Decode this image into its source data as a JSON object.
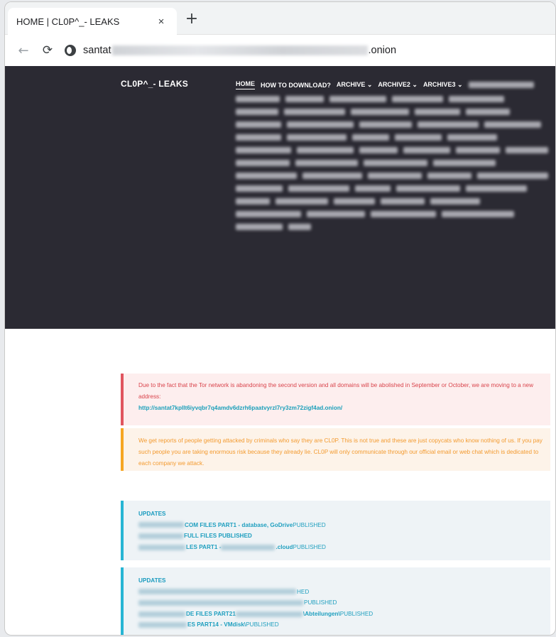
{
  "browser": {
    "tab_title": "HOME | CL0P^_- LEAKS",
    "tab_close": "×",
    "new_tab": "+",
    "back_icon": "←",
    "reload_icon": "⟳",
    "url_prefix": "santat",
    "url_suffix": ".onion"
  },
  "site": {
    "brand": "CL0P^_- LEAKS",
    "nav": {
      "home": "HOME",
      "how_to_download": "HOW TO DOWNLOAD?",
      "archive": "ARCHIVE ⌄",
      "archive2": "ARCHIVE2 ⌄",
      "archive3": "ARCHIVE3 ⌄"
    }
  },
  "notices": {
    "tor": {
      "text": "Due to the fact that the Tor network is abandoning the second version and all domains will be abolished in September or October, we are moving to a new address:",
      "address": "http://santat7kpllt6iyvqbr7q4amdv6dzrh6paatvyrzl7ry3zm72zigf4ad.onion/"
    },
    "copycats": {
      "text": "We get reports of people getting attacked by criminals who say they are CL0P. This is not true and these are just copycats who know nothing of us. If you pay such people you are taking enormous risk because they already lie. CL0P will only communicate through our official email or web chat which is dedicated to each company we attack."
    }
  },
  "updates": [
    {
      "title": "UPDATES",
      "rows": [
        {
          "bold": "COM FILES PART1 - database, GoDrive",
          "normal": " PUBLISHED"
        },
        {
          "bold": "FULL FILES PUBLISHED",
          "normal": ""
        },
        {
          "bold": "LES PART1 - ",
          "bold2": ".cloud",
          "normal": " PUBLISHED"
        }
      ]
    },
    {
      "title": "UPDATES",
      "rows": [
        {
          "normal": "HED"
        },
        {
          "normal": " PUBLISHED"
        },
        {
          "bold": "DE FILES PART21",
          "bold2": "\\Abteilungen\\",
          "normal": " PUBLISHED"
        },
        {
          "bold": "ES PART14 - VMdisk\\",
          "normal": " PUBLISHED"
        }
      ]
    }
  ]
}
